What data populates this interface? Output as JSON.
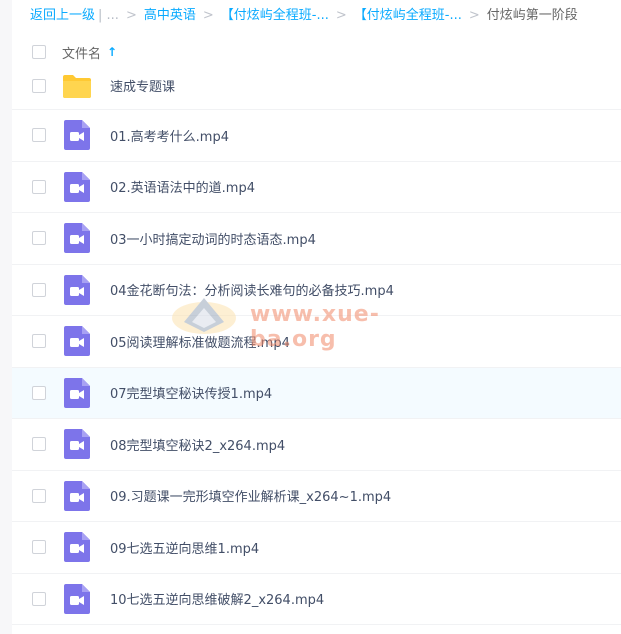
{
  "breadcrumb": {
    "back": "返回上一级",
    "ellipsis": "| ...",
    "crumbs": [
      "高中英语",
      "【付炫屿全程班-...",
      "【付炫屿全程班-..."
    ],
    "current": "付炫屿第一阶段"
  },
  "header": {
    "label": "文件名",
    "sort_icon": "↑"
  },
  "files": [
    {
      "name": "速成专题课",
      "icon": "folder-icon"
    },
    {
      "name": "01.高考考什么.mp4",
      "icon": "video-icon"
    },
    {
      "name": "02.英语语法中的道.mp4",
      "icon": "video-icon"
    },
    {
      "name": "03一小时搞定动词的时态语态.mp4",
      "icon": "video-icon"
    },
    {
      "name": "04金花断句法：分析阅读长难句的必备技巧.mp4",
      "icon": "video-icon"
    },
    {
      "name": "05阅读理解标准做题流程.mp4",
      "icon": "video-icon"
    },
    {
      "name": "07完型填空秘诀传授1.mp4",
      "icon": "video-icon"
    },
    {
      "name": "08完型填空秘诀2_x264.mp4",
      "icon": "video-icon"
    },
    {
      "name": "09.习题课一完形填空作业解析课_x264~1.mp4",
      "icon": "video-icon"
    },
    {
      "name": "09七选五逆向思维1.mp4",
      "icon": "video-icon"
    },
    {
      "name": "10七选五逆向思维破解2_x264.mp4",
      "icon": "video-icon"
    }
  ],
  "watermark": {
    "text": "www.xue-ba.org"
  },
  "colors": {
    "link": "#09aaff",
    "folder": "#ffd04b",
    "video": "#7d74ea",
    "hover_row": "#f4fbff"
  }
}
